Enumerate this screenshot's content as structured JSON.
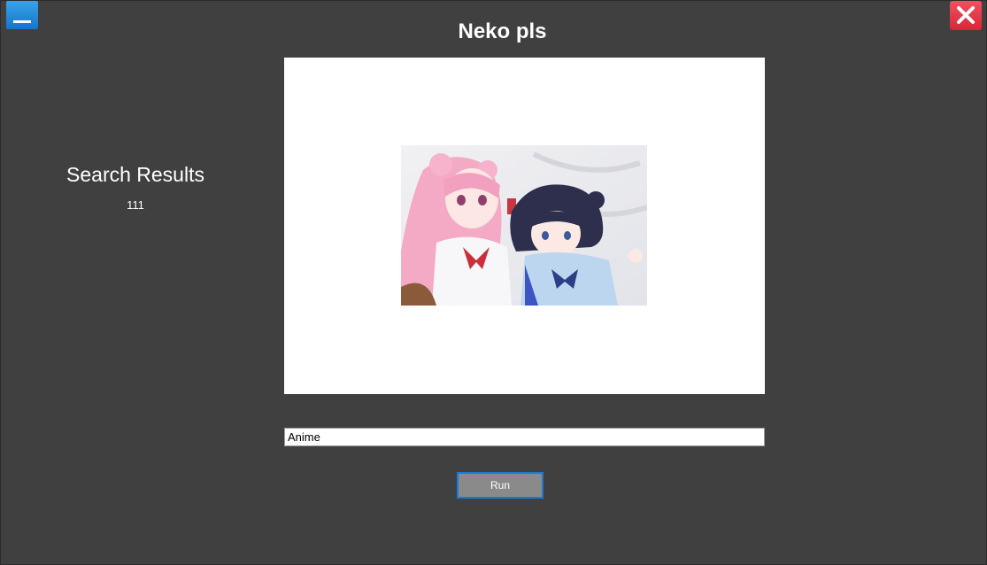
{
  "window": {
    "title": "Neko pls"
  },
  "controls": {
    "minimize_icon": "minimize-icon",
    "close_icon": "close-icon",
    "close_color": "#e23445",
    "minimize_color": "#1f87d8"
  },
  "results": {
    "title": "Search Results",
    "count": "111"
  },
  "image": {
    "subject": "anime-illustration"
  },
  "search": {
    "value": "Anime"
  },
  "run_button": {
    "label": "Run"
  }
}
